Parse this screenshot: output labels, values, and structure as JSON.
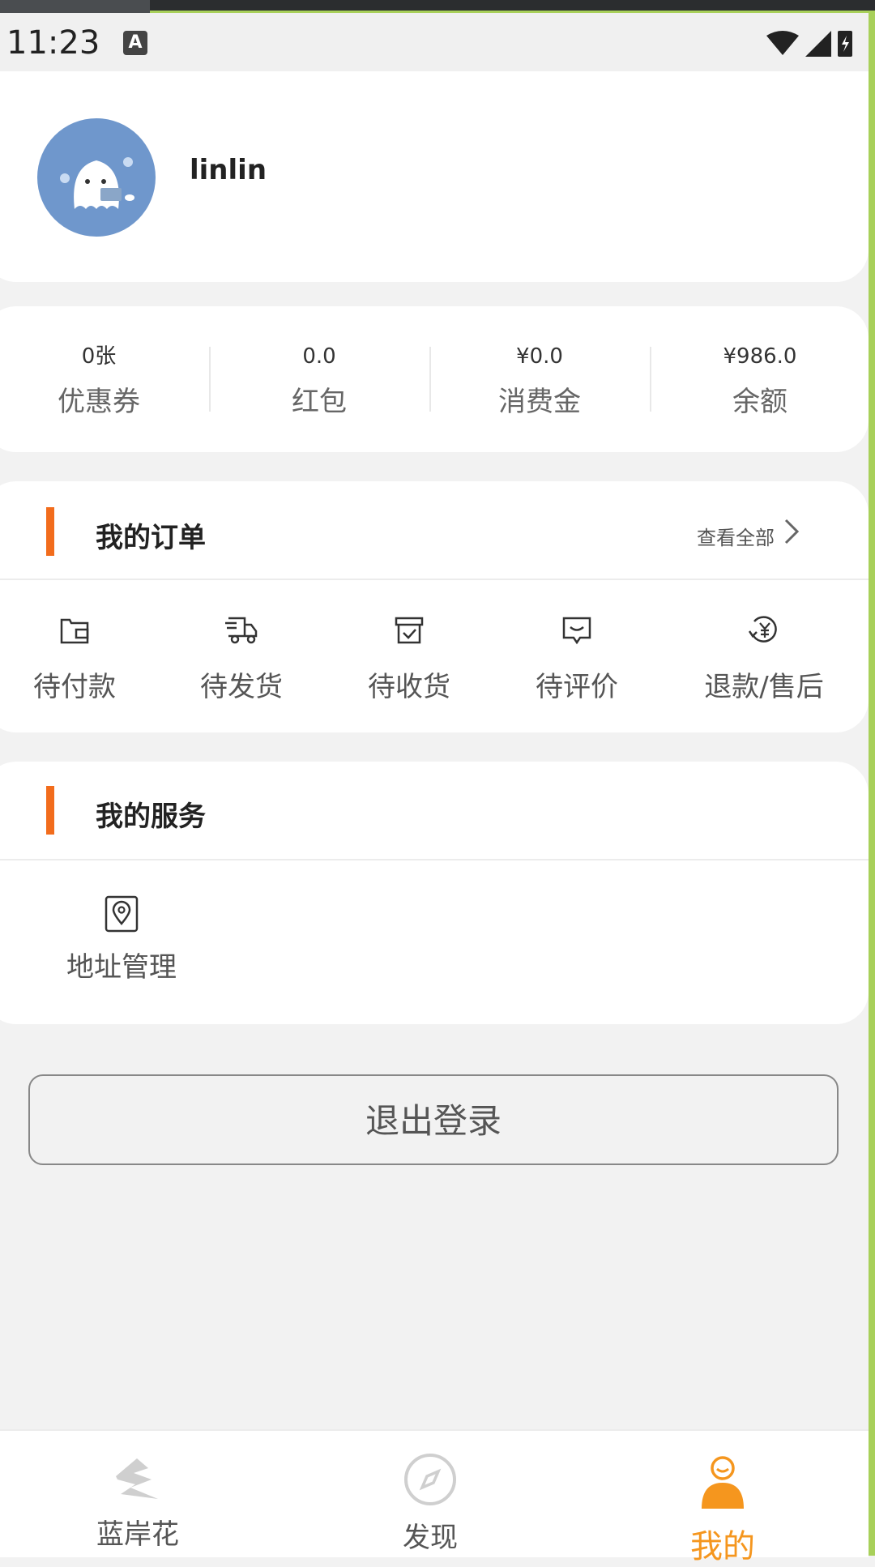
{
  "status_bar": {
    "time": "11:23",
    "app_icon_letter": "A"
  },
  "profile": {
    "username": "linlin",
    "avatar_color": "#6f97cc"
  },
  "assets": [
    {
      "value": "0张",
      "label": "优惠券"
    },
    {
      "value": "0.0",
      "label": "红包"
    },
    {
      "value": "¥0.0",
      "label": "消费金"
    },
    {
      "value": "¥986.0",
      "label": "余额"
    }
  ],
  "orders": {
    "title": "我的订单",
    "see_all": "查看全部",
    "items": [
      {
        "label": "待付款",
        "icon": "wallet-icon"
      },
      {
        "label": "待发货",
        "icon": "truck-icon"
      },
      {
        "label": "待收货",
        "icon": "box-icon"
      },
      {
        "label": "待评价",
        "icon": "comment-icon"
      },
      {
        "label": "退款/售后",
        "icon": "refund-icon"
      }
    ]
  },
  "services": {
    "title": "我的服务",
    "items": [
      {
        "label": "地址管理",
        "icon": "location-icon"
      }
    ]
  },
  "logout_label": "退出登录",
  "tabbar": {
    "items": [
      {
        "label": "蓝岸花",
        "icon": "home-logo-icon",
        "active": false
      },
      {
        "label": "发现",
        "icon": "compass-icon",
        "active": false
      },
      {
        "label": "我的",
        "icon": "profile-icon",
        "active": true
      }
    ],
    "active_color": "#f5961e"
  },
  "colors": {
    "accent_bar": "#f26c1c"
  }
}
